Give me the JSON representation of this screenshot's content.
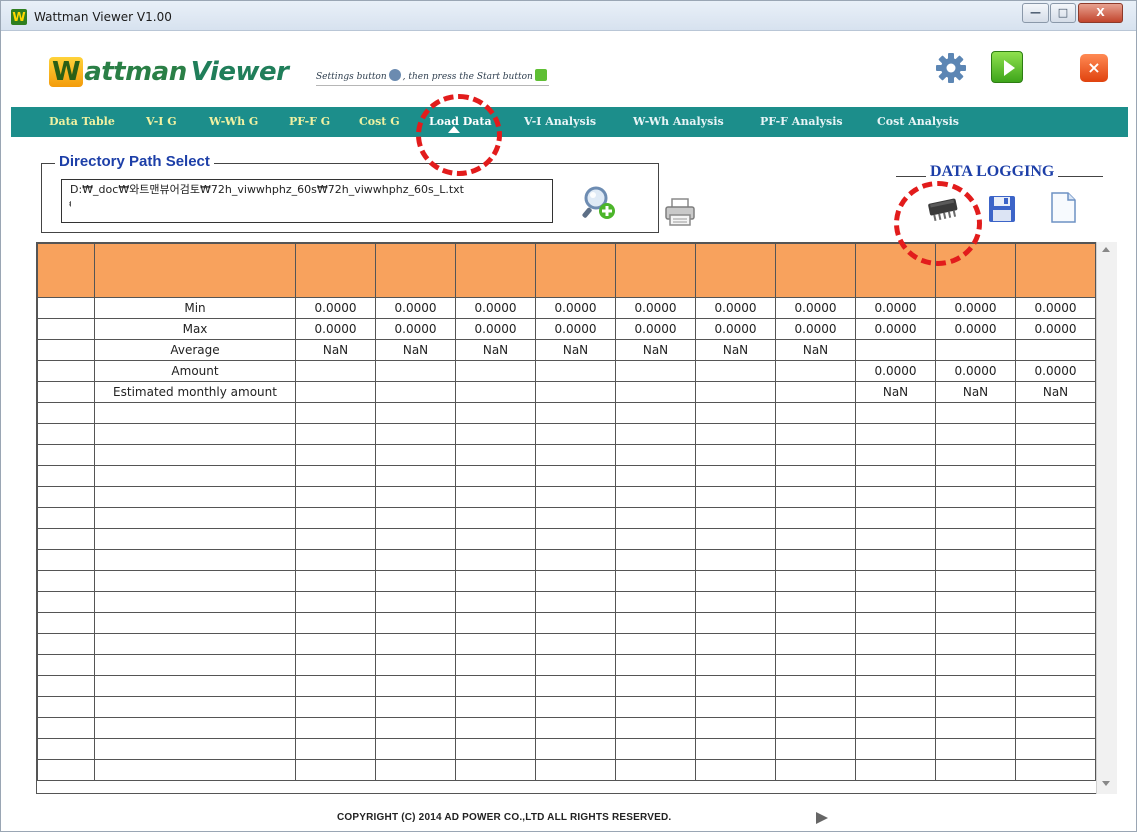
{
  "window": {
    "title": "Wattman Viewer V1.00",
    "icon_letter": "W",
    "buttons": {
      "minimize": "—",
      "maximize": "□",
      "close": "X"
    }
  },
  "header": {
    "logo_first": "W",
    "logo_rest": "attman",
    "logo_viewer": "Viewer",
    "hint_part1": "Settings button",
    "hint_part2": ", then press the Start button",
    "close_glyph": "×"
  },
  "tabs": [
    {
      "label": "Data Table"
    },
    {
      "label": "V-I G"
    },
    {
      "label": "W-Wh G"
    },
    {
      "label": "PF-F G"
    },
    {
      "label": "Cost G"
    },
    {
      "label": "Load Data"
    },
    {
      "label": "V-I Analysis"
    },
    {
      "label": "W-Wh Analysis"
    },
    {
      "label": "PF-F Analysis"
    },
    {
      "label": "Cost Analysis"
    }
  ],
  "directory": {
    "legend": "Directory Path Select",
    "path": "D:₩_doc₩와트맨뷰어검토₩72h_viwwhphz_60s₩72h_viwwhphz_60s_L.txt",
    "caret": "ᅧ"
  },
  "data_logging": {
    "legend": "DATA LOGGING"
  },
  "table": {
    "rows": [
      {
        "label": "Min",
        "cells": [
          "0.0000",
          "0.0000",
          "0.0000",
          "0.0000",
          "0.0000",
          "0.0000",
          "0.0000",
          "0.0000",
          "0.0000",
          "0.0000"
        ]
      },
      {
        "label": "Max",
        "cells": [
          "0.0000",
          "0.0000",
          "0.0000",
          "0.0000",
          "0.0000",
          "0.0000",
          "0.0000",
          "0.0000",
          "0.0000",
          "0.0000"
        ]
      },
      {
        "label": "Average",
        "cells": [
          "NaN",
          "NaN",
          "NaN",
          "NaN",
          "NaN",
          "NaN",
          "NaN",
          "",
          "",
          ""
        ]
      },
      {
        "label": "Amount",
        "cells": [
          "",
          "",
          "",
          "",
          "",
          "",
          "",
          "0.0000",
          "0.0000",
          "0.0000"
        ]
      },
      {
        "label": "Estimated monthly amount",
        "cells": [
          "",
          "",
          "",
          "",
          "",
          "",
          "",
          "NaN",
          "NaN",
          "NaN"
        ]
      }
    ],
    "empty_rows": 18
  },
  "footer": {
    "copyright": "COPYRIGHT (C) 2014 AD POWER CO.,LTD ALL RIGHTS RESERVED."
  },
  "colors": {
    "tab_bar": "#1c8e8b",
    "table_header": "#f8a25d",
    "legend_blue": "#1d3fa8",
    "annotation_red": "#e21c1c"
  }
}
